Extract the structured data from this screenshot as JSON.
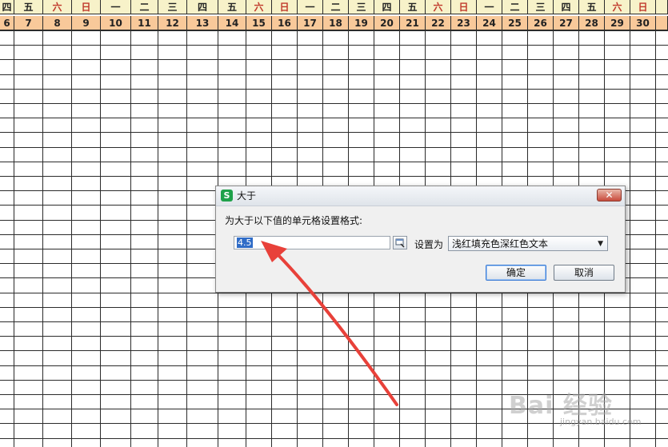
{
  "sheet": {
    "header_weekday_color": "#f7f2c9",
    "header_daynum_color": "#f8c99a",
    "weekend_color": "#c0392b",
    "columns": [
      {
        "weekday": "四",
        "day": "6",
        "weekend": false
      },
      {
        "weekday": "五",
        "day": "7",
        "weekend": false
      },
      {
        "weekday": "六",
        "day": "8",
        "weekend": true
      },
      {
        "weekday": "日",
        "day": "9",
        "weekend": true
      },
      {
        "weekday": "一",
        "day": "10",
        "weekend": false
      },
      {
        "weekday": "二",
        "day": "11",
        "weekend": false
      },
      {
        "weekday": "三",
        "day": "12",
        "weekend": false
      },
      {
        "weekday": "四",
        "day": "13",
        "weekend": false
      },
      {
        "weekday": "五",
        "day": "14",
        "weekend": false
      },
      {
        "weekday": "六",
        "day": "15",
        "weekend": true
      },
      {
        "weekday": "日",
        "day": "16",
        "weekend": true
      },
      {
        "weekday": "一",
        "day": "17",
        "weekend": false
      },
      {
        "weekday": "二",
        "day": "18",
        "weekend": false
      },
      {
        "weekday": "三",
        "day": "19",
        "weekend": false
      },
      {
        "weekday": "四",
        "day": "20",
        "weekend": false
      },
      {
        "weekday": "五",
        "day": "21",
        "weekend": false
      },
      {
        "weekday": "六",
        "day": "22",
        "weekend": true
      },
      {
        "weekday": "日",
        "day": "23",
        "weekend": true
      },
      {
        "weekday": "一",
        "day": "24",
        "weekend": false
      },
      {
        "weekday": "二",
        "day": "25",
        "weekend": false
      },
      {
        "weekday": "三",
        "day": "26",
        "weekend": false
      },
      {
        "weekday": "四",
        "day": "27",
        "weekend": false
      },
      {
        "weekday": "五",
        "day": "28",
        "weekend": false
      },
      {
        "weekday": "六",
        "day": "29",
        "weekend": true
      },
      {
        "weekday": "日",
        "day": "30",
        "weekend": true
      },
      {
        "weekday": "",
        "day": "",
        "weekend": false
      }
    ]
  },
  "dialog": {
    "app_icon": "wps-spreadsheet-icon",
    "app_icon_glyph": "S",
    "title": "大于",
    "close_glyph": "✕",
    "prompt": "为大于以下值的单元格设置格式:",
    "value": "4.5",
    "set_as_label": "设置为",
    "format_selected": "浅红填充色深红色文本",
    "ok_label": "确定",
    "cancel_label": "取消",
    "accent_color": "#3a7bd5"
  },
  "annotation": {
    "arrow_color": "#e8413a"
  },
  "watermark": {
    "text": "Bai  经验",
    "subtext": "jingyan.baidu.com"
  }
}
